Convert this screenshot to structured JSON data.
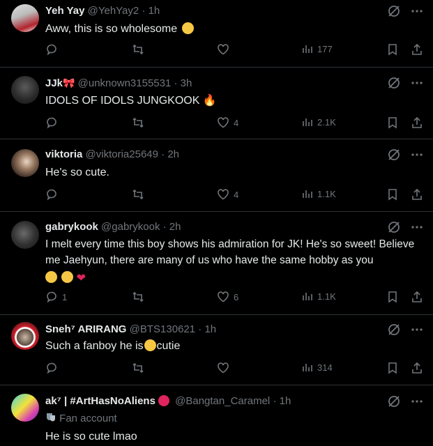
{
  "tweets": [
    {
      "name": "Yeh Yay",
      "handle": "@YehYay2",
      "time": "· 1h",
      "text": "Aww, this is so wholesome",
      "replies": "",
      "likes": "",
      "views": "177"
    },
    {
      "name": "JJk",
      "handle": "@unknown3155531",
      "time": "· 3h",
      "text": "IDOLS OF IDOLS  JUNGKOOK",
      "replies": "",
      "likes": "4",
      "views": "2.1K"
    },
    {
      "name": "viktoria",
      "handle": "@viktoria25649",
      "time": "· 2h",
      "text": "He's so cute.",
      "replies": "",
      "likes": "4",
      "views": "1.1K"
    },
    {
      "name": "gabrykook",
      "handle": "@gabrykook",
      "time": "· 2h",
      "text": "I melt every time this boy shows his admiration for JK! He's so sweet! Believe me Jaehyun, there are many of us who have the same hobby as you",
      "replies": "1",
      "likes": "6",
      "views": "1.1K"
    },
    {
      "name": "Sneh⁷ ARIRANG",
      "handle": "@BTS130621",
      "time": "· 1h",
      "text": "Such a fanboy he is",
      "text_after": "cutie",
      "replies": "",
      "likes": "",
      "views": "314"
    },
    {
      "name": "ak⁷ | #ArtHasNoAliens",
      "handle": "@Bangtan_Caramel",
      "time": "· 1h",
      "label": "Fan account",
      "text": "He is so cute lmao"
    }
  ],
  "icons": {
    "reply": "reply-icon",
    "retweet": "retweet-icon",
    "like": "heart-icon",
    "views": "views-icon",
    "bookmark": "bookmark-icon",
    "share": "share-icon",
    "more": "more-icon",
    "grok": "grok-icon"
  },
  "colors": {
    "background": "#000000",
    "text": "#e7e9ea",
    "muted": "#71767b",
    "divider": "#2f3336"
  }
}
